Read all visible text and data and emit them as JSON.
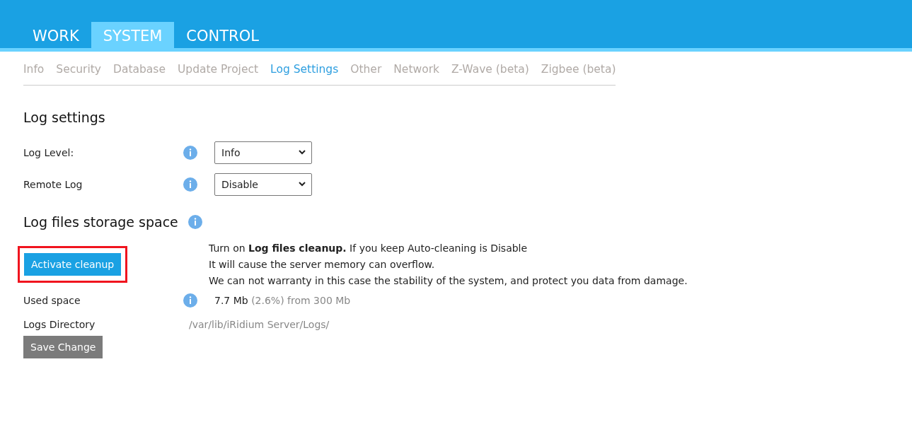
{
  "main_tabs": [
    {
      "label": "WORK",
      "selected": false
    },
    {
      "label": "SYSTEM",
      "selected": true
    },
    {
      "label": "CONTROL",
      "selected": false
    }
  ],
  "sub_tabs": [
    {
      "label": "Info",
      "selected": false
    },
    {
      "label": "Security",
      "selected": false
    },
    {
      "label": "Database",
      "selected": false
    },
    {
      "label": "Update Project",
      "selected": false
    },
    {
      "label": "Log Settings",
      "selected": true
    },
    {
      "label": "Other",
      "selected": false
    },
    {
      "label": "Network",
      "selected": false
    },
    {
      "label": "Z-Wave (beta)",
      "selected": false
    },
    {
      "label": "Zigbee (beta)",
      "selected": false
    }
  ],
  "log_settings": {
    "title": "Log settings",
    "fields": [
      {
        "label": "Log Level:",
        "value": "Info"
      },
      {
        "label": "Remote Log",
        "value": "Disable"
      }
    ]
  },
  "storage": {
    "title": "Log files storage space",
    "button": "Activate cleanup",
    "highlighted": true,
    "notice": [
      "Turn on **Log files cleanup.** If you keep Auto-cleaning is Disable",
      "It will cause the server memory can overflow.",
      "We can not warranty in this case the stability of the system, and protect you data from damage."
    ],
    "used_space": {
      "label": "Used space",
      "value": "7.7 Mb",
      "detail": "(2.6%) from 300 Mb"
    },
    "directory": {
      "label": "Logs Directory",
      "value": "/var/lib/iRidium Server/Logs/"
    },
    "save_button": "Save Change"
  }
}
